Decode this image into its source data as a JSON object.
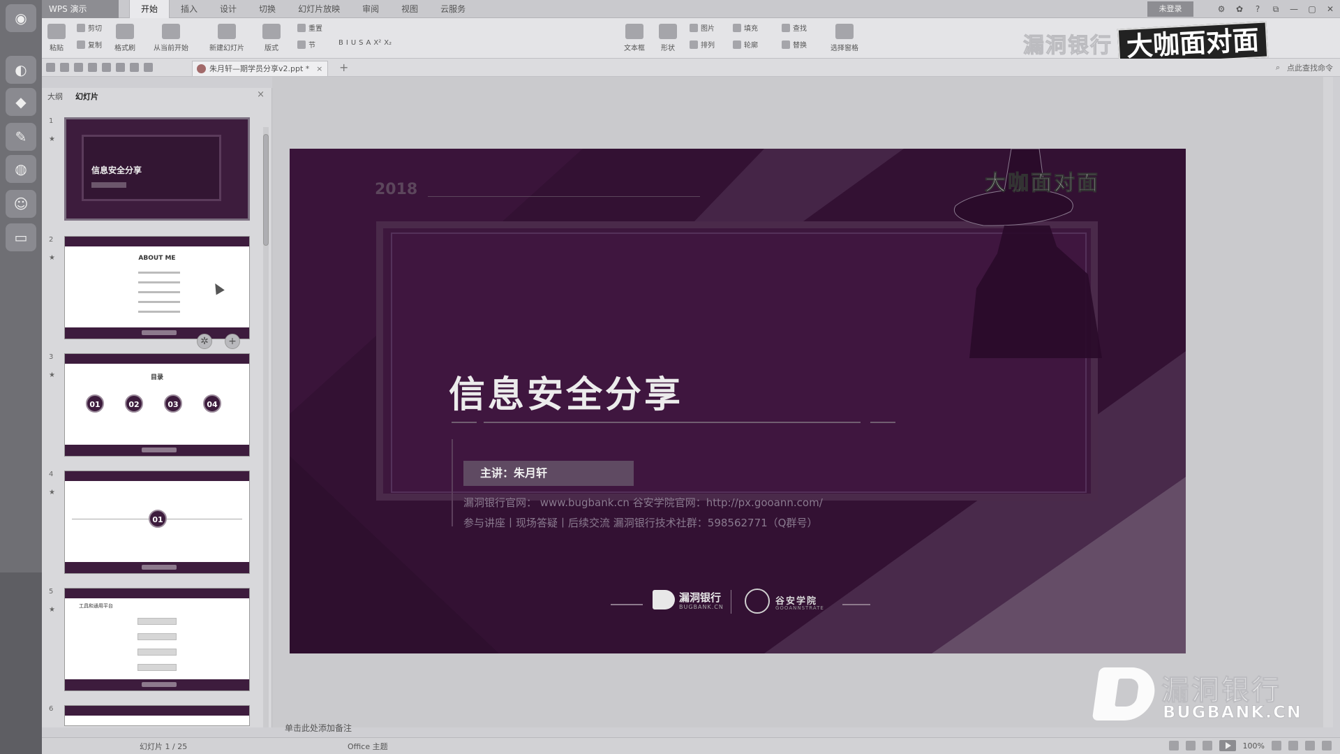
{
  "app": {
    "badge": "WPS 演示",
    "tabs": [
      "开始",
      "插入",
      "设计",
      "切换",
      "幻灯片放映",
      "审阅",
      "视图",
      "云服务"
    ],
    "active_tab": "开始",
    "user": "未登录"
  },
  "ribbon": {
    "paste": "粘贴",
    "cut": "剪切",
    "copy": "复制",
    "format_painter": "格式刷",
    "from_start": "从当前开始",
    "new_slide": "新建幻灯片",
    "layout": "版式",
    "reset": "重置",
    "section": "节",
    "textbox": "文本框",
    "shape": "形状",
    "picture": "图片",
    "fill": "填充",
    "arrange": "排列",
    "outline": "轮廓",
    "find": "查找",
    "replace": "替换",
    "select_pane": "选择窗格",
    "format_marks": [
      "B",
      "I",
      "U",
      "S",
      "A",
      "X²",
      "X₂"
    ]
  },
  "quickbar": {
    "doc_tab": "朱月轩—期学员分享v2.ppt *",
    "new_tab": "+",
    "right_text": "点此查找命令"
  },
  "watermark_top": {
    "text": "漏洞银行",
    "brand": "大咖面对面"
  },
  "panel": {
    "tab_outline": "大纲",
    "tab_slides": "幻灯片",
    "close": "×",
    "thumbs": [
      {
        "num": "1",
        "title": "信息安全分享"
      },
      {
        "num": "2",
        "title": "ABOUT ME"
      },
      {
        "num": "3",
        "title": "目录",
        "circles": [
          "01",
          "02",
          "03",
          "04"
        ]
      },
      {
        "num": "4",
        "circle": "01"
      },
      {
        "num": "5",
        "title": "工具和通用平台"
      },
      {
        "num": "6"
      }
    ]
  },
  "slide": {
    "year": "2018",
    "title": "信息安全分享",
    "presenter": "主讲：朱月轩",
    "line1": "漏洞银行官网： www.bugbank.cn    谷安学院官网：http://px.gooann.com/",
    "line2": "参与讲座丨现场答疑丨后续交流   漏洞银行技术社群：598562771（Q群号）",
    "hat_text": "大咖面对面",
    "logo_bug": "漏洞银行",
    "logo_bug_sub": "BUGBANK.CN",
    "logo_gu": "谷安学院",
    "logo_gu_sub": "GOOANNSTRATE"
  },
  "notes_placeholder": "单击此处添加备注",
  "watermark_bottom": {
    "text": "漏洞银行",
    "sub": "BUGBANK.CN"
  },
  "status": {
    "slide_count": "幻灯片 1 / 25",
    "theme": "Office 主题",
    "zoom": "100%"
  },
  "colors": {
    "slide_bg": "#331133",
    "accent": "#3d1c3d"
  }
}
